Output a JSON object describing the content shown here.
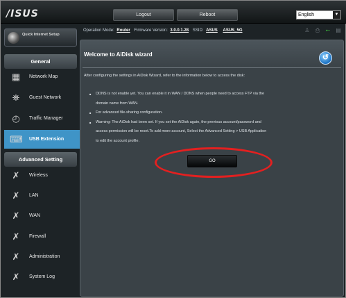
{
  "header": {
    "logo": "/ISUS",
    "logout_label": "Logout",
    "reboot_label": "Reboot",
    "language": "English"
  },
  "status": {
    "mode_label": "Operation Mode:",
    "mode_value": "Router",
    "firmware_label": "Firmware Version:",
    "firmware_value": "3.0.0.1.28",
    "ssid_label": "SSID:",
    "ssid_values": [
      "ASUS",
      "ASUS_5G"
    ],
    "icons": [
      "user-icon",
      "printer-icon",
      "usb-icon",
      "clipboard-icon"
    ]
  },
  "sidebar": {
    "quick_setup": "Quick Internet Setup",
    "general_header": "General",
    "general_items": [
      {
        "label": "Network Map",
        "icon": "network-map-icon"
      },
      {
        "label": "Guest Network",
        "icon": "guest-network-icon"
      },
      {
        "label": "Traffic Manager",
        "icon": "traffic-manager-icon"
      },
      {
        "label": "USB Extension",
        "icon": "usb-extension-icon",
        "active": true
      }
    ],
    "advanced_header": "Advanced Setting",
    "advanced_items": [
      {
        "label": "Wireless",
        "icon": "wrench-icon"
      },
      {
        "label": "LAN",
        "icon": "wrench-icon"
      },
      {
        "label": "WAN",
        "icon": "wrench-icon"
      },
      {
        "label": "Firewall",
        "icon": "wrench-icon"
      },
      {
        "label": "Administration",
        "icon": "wrench-icon"
      },
      {
        "label": "System Log",
        "icon": "wrench-icon"
      }
    ]
  },
  "panel": {
    "title": "Welcome to AiDisk wizard",
    "intro": "After configuring the settings in AiDisk Wizard, refer to the information below to access the disk:",
    "bullets": [
      "DDNS is not enable yet. You can enable it in WAN / DDNS when people need to access FTP via the",
      "domain name from WAN.",
      "For advanced file-sharing configuration.",
      "Warning: The AiDisk had been set. If you set the AiDisk again, the previous account/password and",
      "access permission will be reset.To add more account, Select the Advanced Setting > USB Application",
      "to edit the account profile."
    ],
    "go_label": "GO"
  },
  "colors": {
    "accent": "#3f94c7",
    "highlight": "#e32020",
    "background": "#1d2326"
  }
}
